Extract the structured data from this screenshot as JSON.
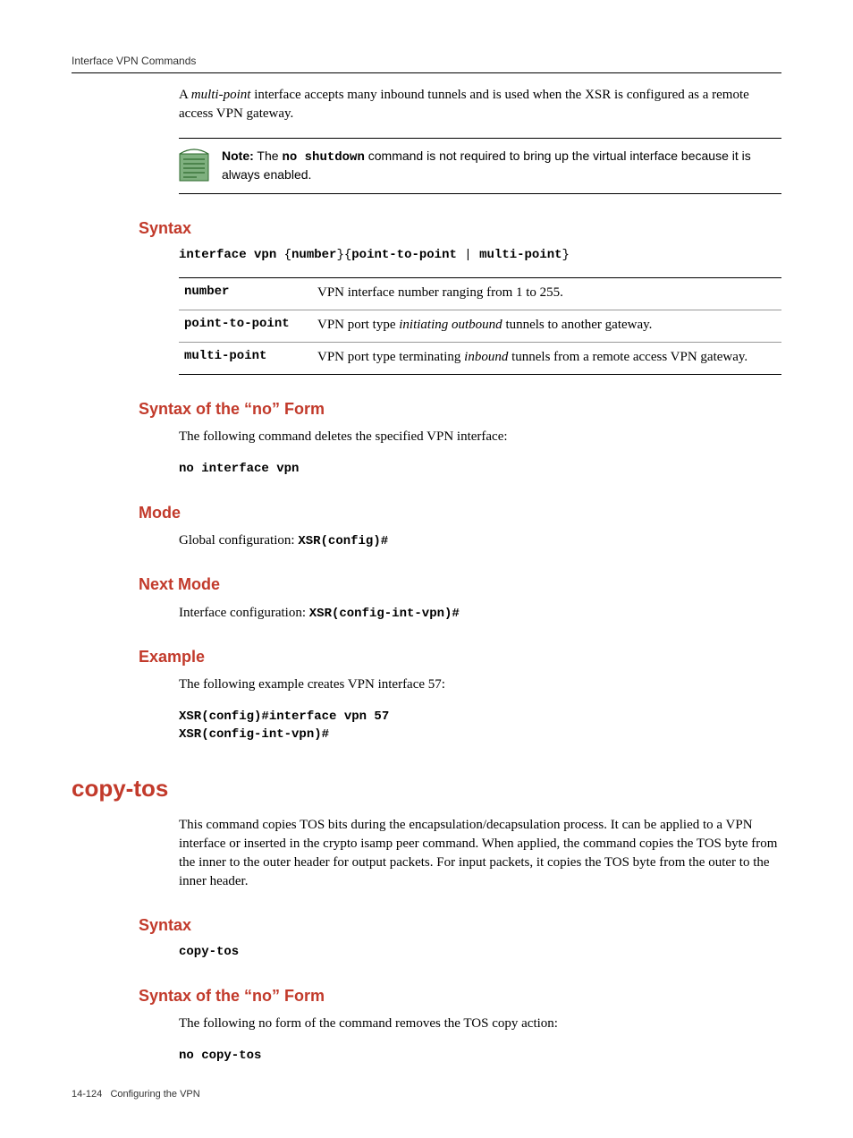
{
  "header": {
    "title": "Interface VPN Commands"
  },
  "intro": {
    "p1_a": "A ",
    "p1_em": "multi-point",
    "p1_b": " interface accepts many inbound tunnels and is used when the XSR is configured as a remote access VPN gateway."
  },
  "note": {
    "label": "Note:",
    "a": " The ",
    "code": "no shutdown",
    "b": " command is not required to bring up the virtual interface because it is always enabled."
  },
  "syntax1": {
    "heading": "Syntax",
    "cmd_a": "interface vpn ",
    "brace_open": "{",
    "cmd_b": "number",
    "brace_mid1": "}{",
    "cmd_c": "point-to-point",
    "pipe": " | ",
    "cmd_d": "multi-point",
    "brace_close": "}",
    "rows": [
      {
        "k": "number",
        "v_a": "VPN interface number ranging from 1 to 255."
      },
      {
        "k": "point-to-point",
        "v_a": "VPN port type ",
        "v_em": "initiating outbound",
        "v_b": " tunnels to another gateway."
      },
      {
        "k": "multi-point",
        "v_a": "VPN port type terminating ",
        "v_em": "inbound",
        "v_b": " tunnels from a remote access VPN gateway."
      }
    ]
  },
  "syntax_no1": {
    "heading": "Syntax of the “no” Form",
    "text": "The following command deletes the specified VPN interface:",
    "cmd": "no interface vpn"
  },
  "mode": {
    "heading": "Mode",
    "text": "Global configuration: ",
    "code": "XSR(config)#"
  },
  "next_mode": {
    "heading": "Next Mode",
    "text": "Interface configuration: ",
    "code": "XSR(config-int-vpn)#"
  },
  "example": {
    "heading": "Example",
    "text": "The following example creates VPN interface 57:",
    "block": "XSR(config)#interface vpn 57\nXSR(config-int-vpn)#"
  },
  "copy_tos": {
    "title": "copy-tos",
    "desc": "This command copies TOS bits during the encapsulation/decapsulation process. It can be applied to a VPN interface or inserted in the crypto isamp peer command. When applied, the command copies the TOS byte from the inner to the outer header for output packets. For input packets, it copies the TOS byte from the outer to the inner header."
  },
  "syntax2": {
    "heading": "Syntax",
    "cmd": "copy-tos"
  },
  "syntax_no2": {
    "heading": "Syntax of the “no” Form",
    "text": "The following no form of the command removes the TOS copy action:",
    "cmd": "no copy-tos"
  },
  "footer": {
    "page": "14-124",
    "chapter": "Configuring the VPN"
  }
}
